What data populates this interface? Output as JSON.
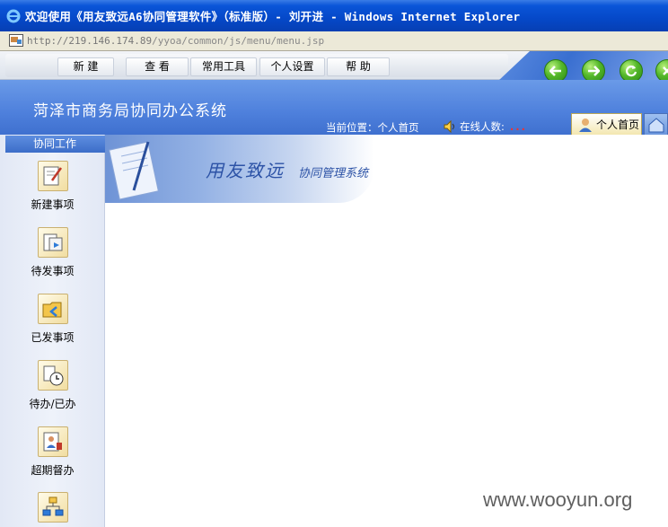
{
  "window": {
    "title": "欢迎使用《用友致远A6协同管理软件》（标准版）- 刘开进 - Windows Internet Explorer"
  },
  "address": {
    "url_host": "http://219.146.174.89",
    "url_path": "/yyoa/common/js/menu/menu.jsp"
  },
  "menu": {
    "items": [
      "新  建",
      "查  看",
      "常用工具",
      "个人设置",
      "帮  助"
    ]
  },
  "nav_buttons": [
    "back-icon",
    "forward-icon",
    "refresh-icon",
    "close-icon"
  ],
  "header": {
    "org_name": "菏泽市商务局协同办公系统",
    "location": "当前位置：个人首页",
    "online_label": "在线人数:",
    "online_value": "...",
    "home_tab": "个人首页"
  },
  "sidebar": {
    "title": "协同工作",
    "items": [
      {
        "label": "新建事项",
        "icon": "new-item-icon"
      },
      {
        "label": "待发事项",
        "icon": "pending-send-icon"
      },
      {
        "label": "已发事项",
        "icon": "sent-items-icon"
      },
      {
        "label": "待办/已办",
        "icon": "todo-done-icon"
      },
      {
        "label": "超期督办",
        "icon": "overdue-supervise-icon"
      },
      {
        "label": "",
        "icon": "workflow-icon"
      }
    ]
  },
  "brand": {
    "name": "用友致远",
    "subtitle": "协同管理系统"
  },
  "watermark": "www.wooyun.org",
  "colors": {
    "titlebar": "#0548c8",
    "header": "#4e80dc",
    "brand_text": "#2c52a6",
    "online_dots": "#ee3333"
  }
}
